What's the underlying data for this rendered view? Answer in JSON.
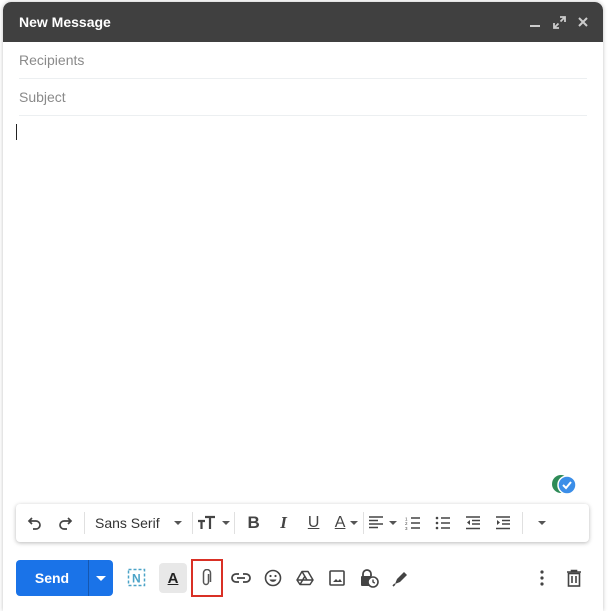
{
  "window": {
    "title": "New Message",
    "controls": [
      {
        "name": "minimize-icon"
      },
      {
        "name": "fullscreen-icon"
      },
      {
        "name": "close-icon"
      }
    ]
  },
  "fields": {
    "recipients": {
      "placeholder": "Recipients",
      "value": ""
    },
    "subject": {
      "placeholder": "Subject",
      "value": ""
    }
  },
  "body": {
    "value": ""
  },
  "formatting_toolbar": {
    "font": "Sans Serif",
    "buttons": [
      "undo",
      "redo",
      "font",
      "font-size",
      "bold",
      "italic",
      "underline",
      "text-color",
      "align",
      "numbered-list",
      "bulleted-list",
      "indent-less",
      "indent-more",
      "more-formatting"
    ]
  },
  "bottom_toolbar": {
    "send_label": "Send",
    "icons": [
      "send-options",
      "notion-extension",
      "formatting-options",
      "attach-files",
      "insert-link",
      "insert-emoji",
      "insert-drive-file",
      "insert-photo",
      "confidential-mode",
      "insert-signature",
      "more-options",
      "discard-draft"
    ],
    "highlighted": "attach-files",
    "highlight_color": "#d93025"
  },
  "colors": {
    "titlebar": "#404040",
    "send": "#1a73e8"
  }
}
